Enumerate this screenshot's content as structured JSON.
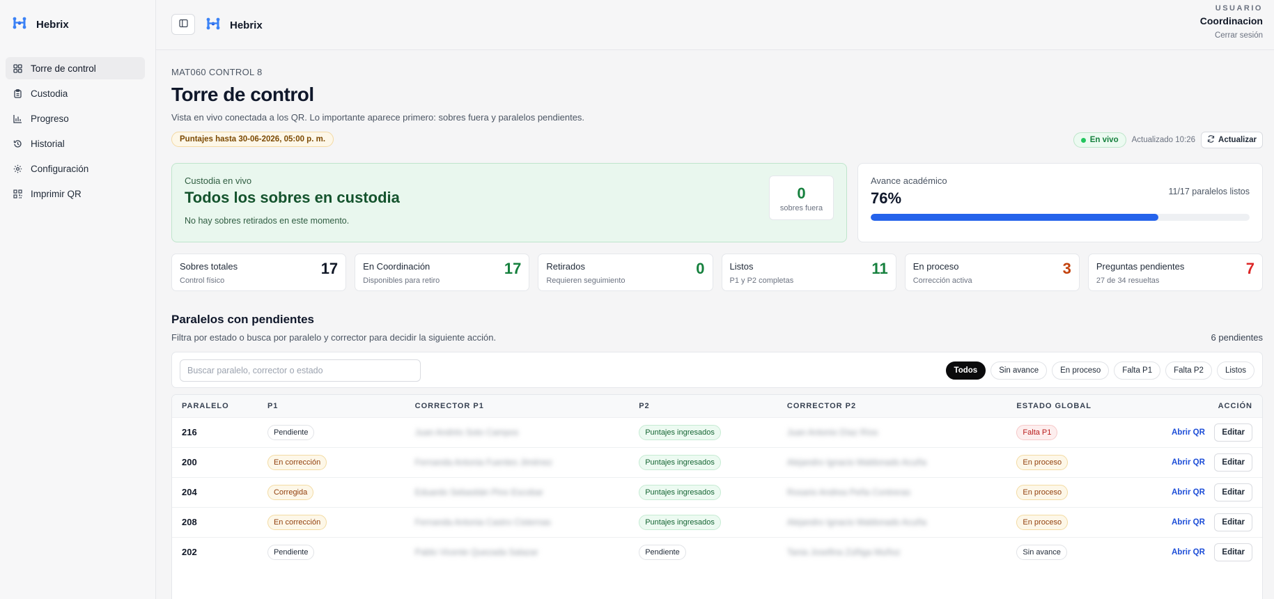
{
  "app": {
    "name": "Hebrix"
  },
  "sidebar": {
    "items": [
      {
        "label": "Torre de control",
        "icon": "grid-icon",
        "active": true
      },
      {
        "label": "Custodia",
        "icon": "clipboard-icon",
        "active": false
      },
      {
        "label": "Progreso",
        "icon": "bar-chart-icon",
        "active": false
      },
      {
        "label": "Historial",
        "icon": "history-icon",
        "active": false
      },
      {
        "label": "Configuración",
        "icon": "gear-icon",
        "active": false
      },
      {
        "label": "Imprimir QR",
        "icon": "qr-icon",
        "active": false
      }
    ]
  },
  "user": {
    "role": "USUARIO",
    "name": "Coordinacion",
    "logout": "Cerrar sesión"
  },
  "header": {
    "eyebrow": "MAT060 CONTROL 8",
    "title": "Torre de control",
    "description": "Vista en vivo conectada a los QR. Lo importante aparece primero: sobres fuera y paralelos pendientes.",
    "deadline": "Puntajes hasta 30-06-2026, 05:00 p. m.",
    "live": "En vivo",
    "updated": "Actualizado 10:26",
    "refresh": "Actualizar"
  },
  "custody": {
    "label": "Custodia en vivo",
    "title": "Todos los sobres en custodia",
    "subtitle": "No hay sobres retirados en este momento.",
    "out_count": "0",
    "out_label": "sobres fuera"
  },
  "progress": {
    "label": "Avance académico",
    "percent_text": "76%",
    "percent": 0.76,
    "ready_text": "11/17 paralelos listos"
  },
  "stats": [
    {
      "label": "Sobres totales",
      "sub": "Control físico",
      "value": "17",
      "color": "#111827"
    },
    {
      "label": "En Coordinación",
      "sub": "Disponibles para retiro",
      "value": "17",
      "color": "#15803d"
    },
    {
      "label": "Retirados",
      "sub": "Requieren seguimiento",
      "value": "0",
      "color": "#15803d"
    },
    {
      "label": "Listos",
      "sub": "P1 y P2 completas",
      "value": "11",
      "color": "#15803d"
    },
    {
      "label": "En proceso",
      "sub": "Corrección activa",
      "value": "3",
      "color": "#c2410c"
    },
    {
      "label": "Preguntas pendientes",
      "sub": "27 de 34 resueltas",
      "value": "7",
      "color": "#dc2626"
    }
  ],
  "pending": {
    "title": "Paralelos con pendientes",
    "description": "Filtra por estado o busca por paralelo y corrector para decidir la siguiente acción.",
    "count": "6 pendientes",
    "search_placeholder": "Buscar paralelo, corrector o estado",
    "filters": [
      {
        "label": "Todos",
        "active": true
      },
      {
        "label": "Sin avance",
        "active": false
      },
      {
        "label": "En proceso",
        "active": false
      },
      {
        "label": "Falta P1",
        "active": false
      },
      {
        "label": "Falta P2",
        "active": false
      },
      {
        "label": "Listos",
        "active": false
      }
    ]
  },
  "table": {
    "columns": [
      "PARALELO",
      "P1",
      "CORRECTOR P1",
      "P2",
      "CORRECTOR P2",
      "ESTADO GLOBAL",
      "ACCIÓN"
    ],
    "action_link": "Abrir QR",
    "action_button": "Editar",
    "rows": [
      {
        "paralelo": "216",
        "p1": "Pendiente",
        "p1_tone": "neutral",
        "corrector_p1": "Juan Andrés Soto Campos",
        "p2": "Puntajes ingresados",
        "p2_tone": "green",
        "corrector_p2": "Juan Antonio Díaz Ríos",
        "estado": "Falta P1",
        "estado_tone": "red"
      },
      {
        "paralelo": "200",
        "p1": "En corrección",
        "p1_tone": "amber",
        "corrector_p1": "Fernanda Antonia Fuentes Jiménez",
        "p2": "Puntajes ingresados",
        "p2_tone": "green",
        "corrector_p2": "Alejandro Ignacio Maldonado Acuña",
        "estado": "En proceso",
        "estado_tone": "amber"
      },
      {
        "paralelo": "204",
        "p1": "Corregida",
        "p1_tone": "amber",
        "corrector_p1": "Eduardo Sebastián Pino Escobar",
        "p2": "Puntajes ingresados",
        "p2_tone": "green",
        "corrector_p2": "Rosario Andrea Peña Contreras",
        "estado": "En proceso",
        "estado_tone": "amber"
      },
      {
        "paralelo": "208",
        "p1": "En corrección",
        "p1_tone": "amber",
        "corrector_p1": "Fernanda Antonia Castro Cisternas",
        "p2": "Puntajes ingresados",
        "p2_tone": "green",
        "corrector_p2": "Alejandro Ignacio Maldonado Acuña",
        "estado": "En proceso",
        "estado_tone": "amber"
      },
      {
        "paralelo": "202",
        "p1": "Pendiente",
        "p1_tone": "neutral",
        "corrector_p1": "Pablo Vicente Quezada Salazar",
        "p2": "Pendiente",
        "p2_tone": "neutral",
        "corrector_p2": "Tania Josefina Zúñiga Muñoz",
        "estado": "Sin avance",
        "estado_tone": "neutral"
      }
    ]
  }
}
